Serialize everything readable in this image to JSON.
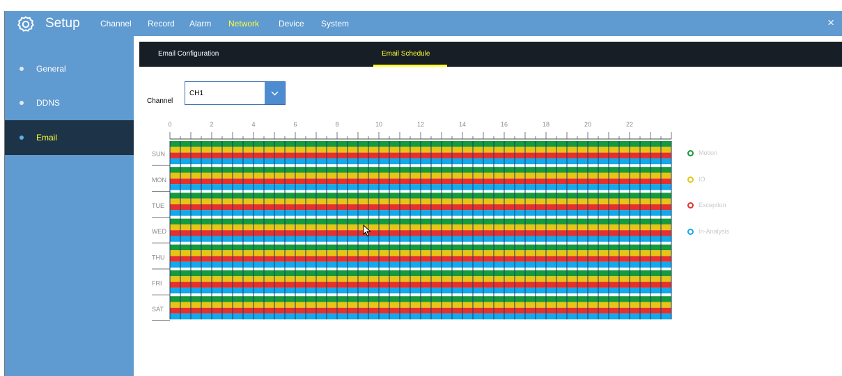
{
  "app": {
    "title": "Setup",
    "close_glyph": "×",
    "accent_color": "#ffff33",
    "icons": {
      "settings": "gear-icon",
      "close": "close-icon",
      "dropdown": "chevron-down-icon"
    }
  },
  "menu": [
    {
      "label": "Channel",
      "active": false
    },
    {
      "label": "Record",
      "active": false
    },
    {
      "label": "Alarm",
      "active": false
    },
    {
      "label": "Network",
      "active": true
    },
    {
      "label": "Device",
      "active": false
    },
    {
      "label": "System",
      "active": false
    }
  ],
  "sidebar": {
    "items": [
      {
        "label": "General",
        "active": false
      },
      {
        "label": "DDNS",
        "active": false
      },
      {
        "label": "Email",
        "active": true
      }
    ]
  },
  "tabs": [
    {
      "label": "Email Configuration",
      "active": false
    },
    {
      "label": "Email Schedule",
      "active": true
    }
  ],
  "channel": {
    "label": "Channel",
    "value": "CH1"
  },
  "schedule": {
    "hour_labels": [
      "0",
      "2",
      "4",
      "6",
      "8",
      "10",
      "12",
      "14",
      "16",
      "18",
      "20",
      "22"
    ],
    "days": [
      "SUN",
      "MON",
      "TUE",
      "WED",
      "THU",
      "FRI",
      "SAT"
    ],
    "all_hours_selected": true
  },
  "legend": [
    {
      "label": "Motion",
      "color": "#159a3c"
    },
    {
      "label": "IO",
      "color": "#e7c516"
    },
    {
      "label": "Exception",
      "color": "#e5312e"
    },
    {
      "label": "In-Analysis",
      "color": "#13a9ea"
    }
  ]
}
